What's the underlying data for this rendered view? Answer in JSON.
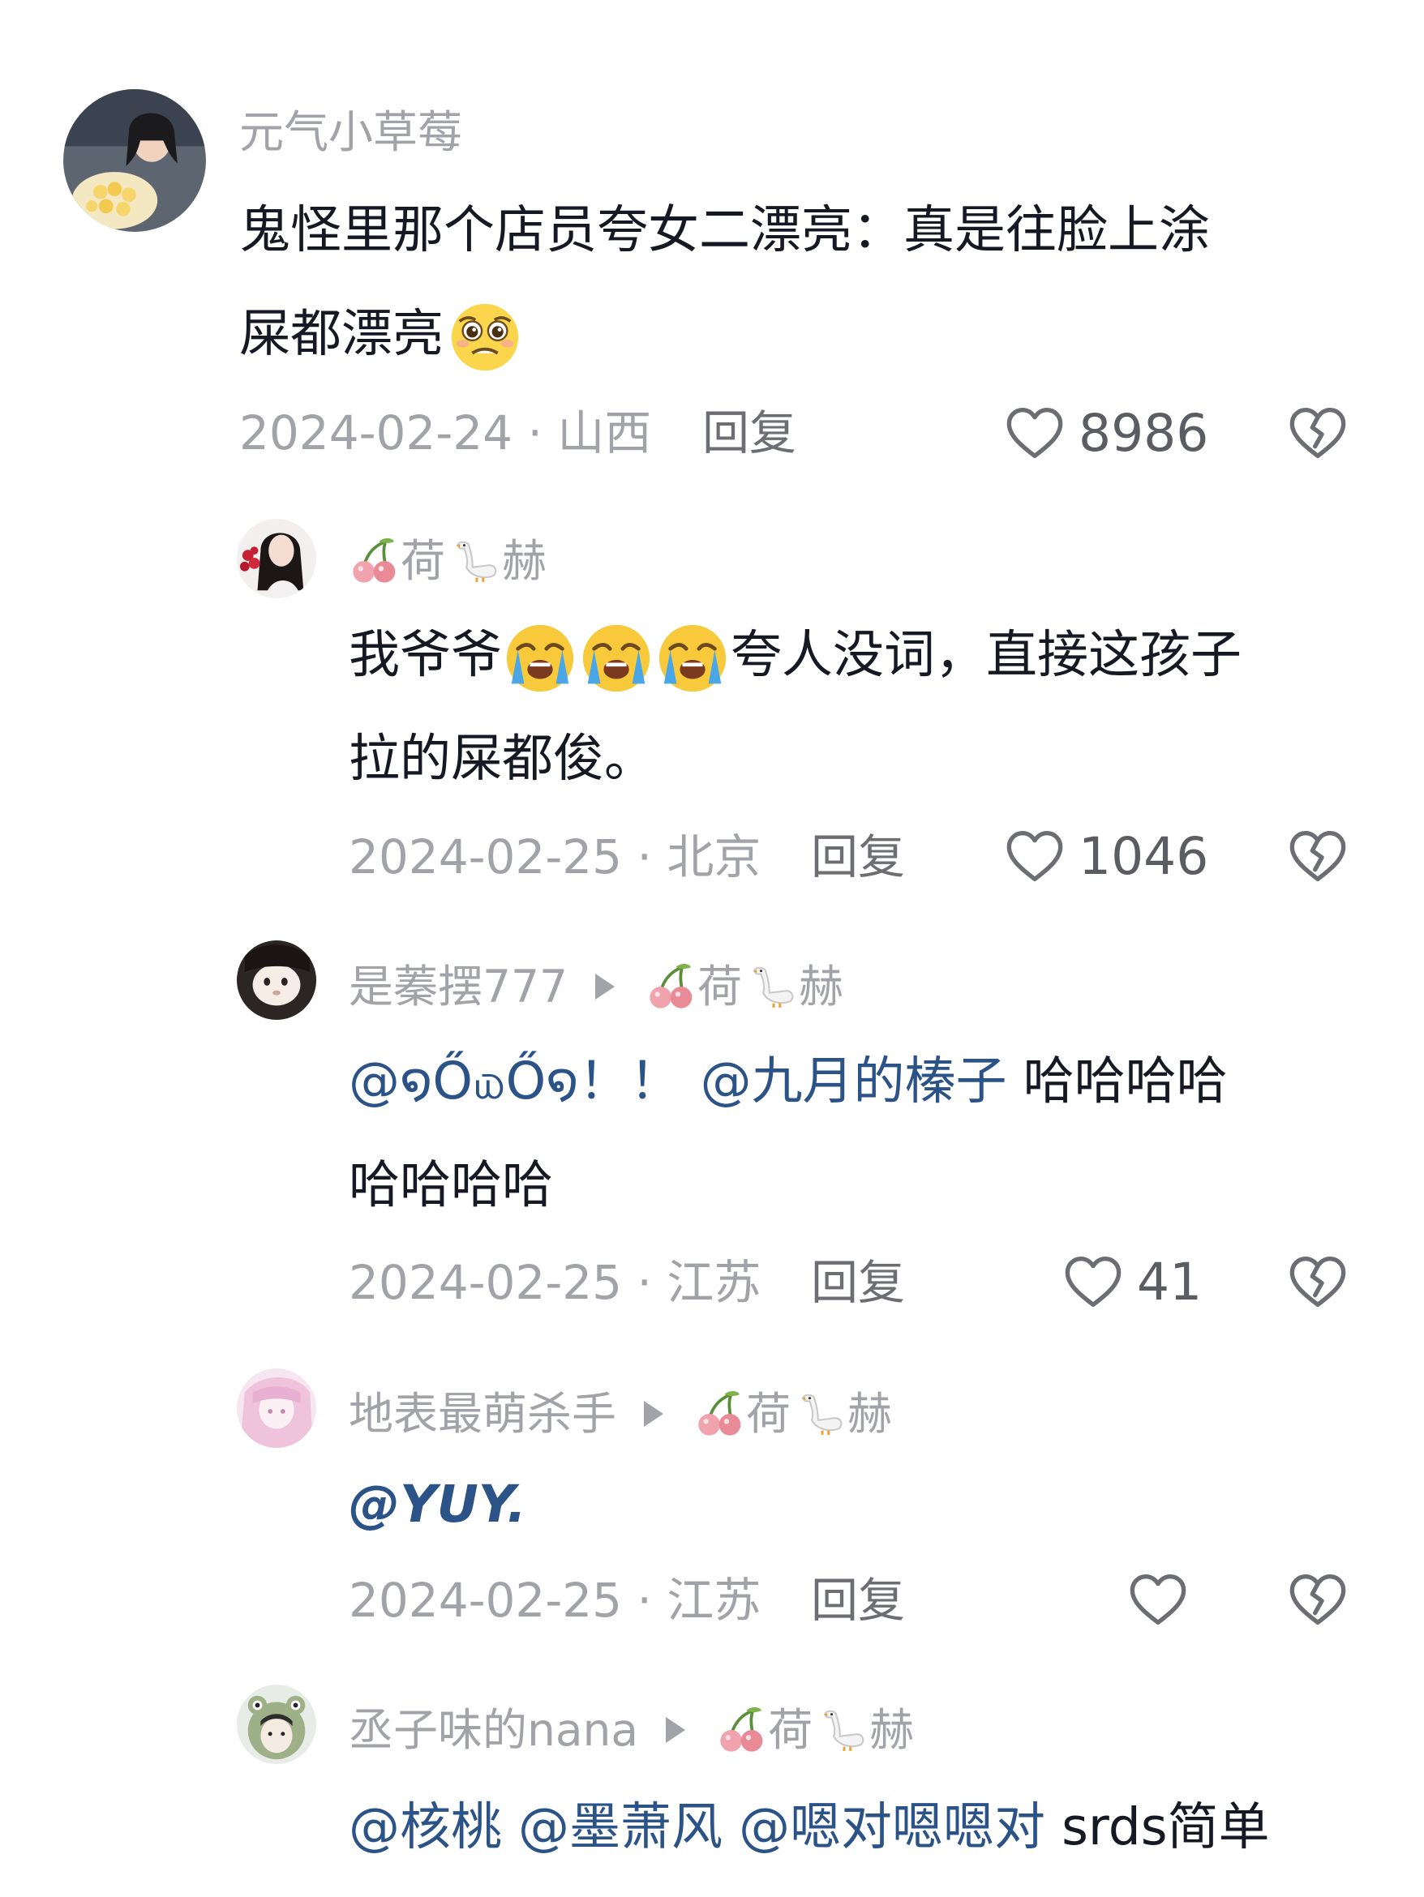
{
  "comments": [
    {
      "username": "元气小草莓",
      "line1": "鬼怪里那个店员夸女二漂亮：真是往脸上涂",
      "line2": "屎都漂亮",
      "date_location": "2024-02-24 · 山西",
      "reply_label": "回复",
      "like_count": "8986"
    },
    {
      "username_suffix_a": "荷",
      "username_suffix_b": "赫",
      "line1_a": "我爷爷",
      "line1_b": "夸人没词，直接这孩子",
      "line2": "拉的屎都俊。",
      "date_location": "2024-02-25 · 北京",
      "reply_label": "回复",
      "like_count": "1046"
    },
    {
      "username": "是蓁摆777",
      "reply_to_a": "荷",
      "reply_to_b": "赫",
      "mention1": "@໑Ő௰Ő໑",
      "punct": "！！",
      "mention2": "@九月的榛子",
      "line1_tail": "哈哈哈哈",
      "line2": "哈哈哈哈",
      "date_location": "2024-02-25 · 江苏",
      "reply_label": "回复",
      "like_count": "41"
    },
    {
      "username": "地表最萌杀手",
      "reply_to_a": "荷",
      "reply_to_b": "赫",
      "mention": "@YUY.",
      "date_location": "2024-02-25 · 江苏",
      "reply_label": "回复",
      "like_count": ""
    },
    {
      "username": "丞子味的nana",
      "reply_to_a": "荷",
      "reply_to_b": "赫",
      "mention1": "@核桃",
      "mention2": "@墨萧风",
      "mention3": "@嗯对嗯嗯对",
      "tail": "srds简单"
    }
  ],
  "icons": {
    "like": "heart-outline-icon",
    "dislike": "broken-heart-icon",
    "cherry": "cherry-emoji",
    "goose": "goose-emoji",
    "crying": "loudly-crying-emoji",
    "pleading": "pleading-emoji"
  },
  "colors": {
    "text": "#161823",
    "meta": "#a1a3a8",
    "mention": "#2b5387"
  }
}
